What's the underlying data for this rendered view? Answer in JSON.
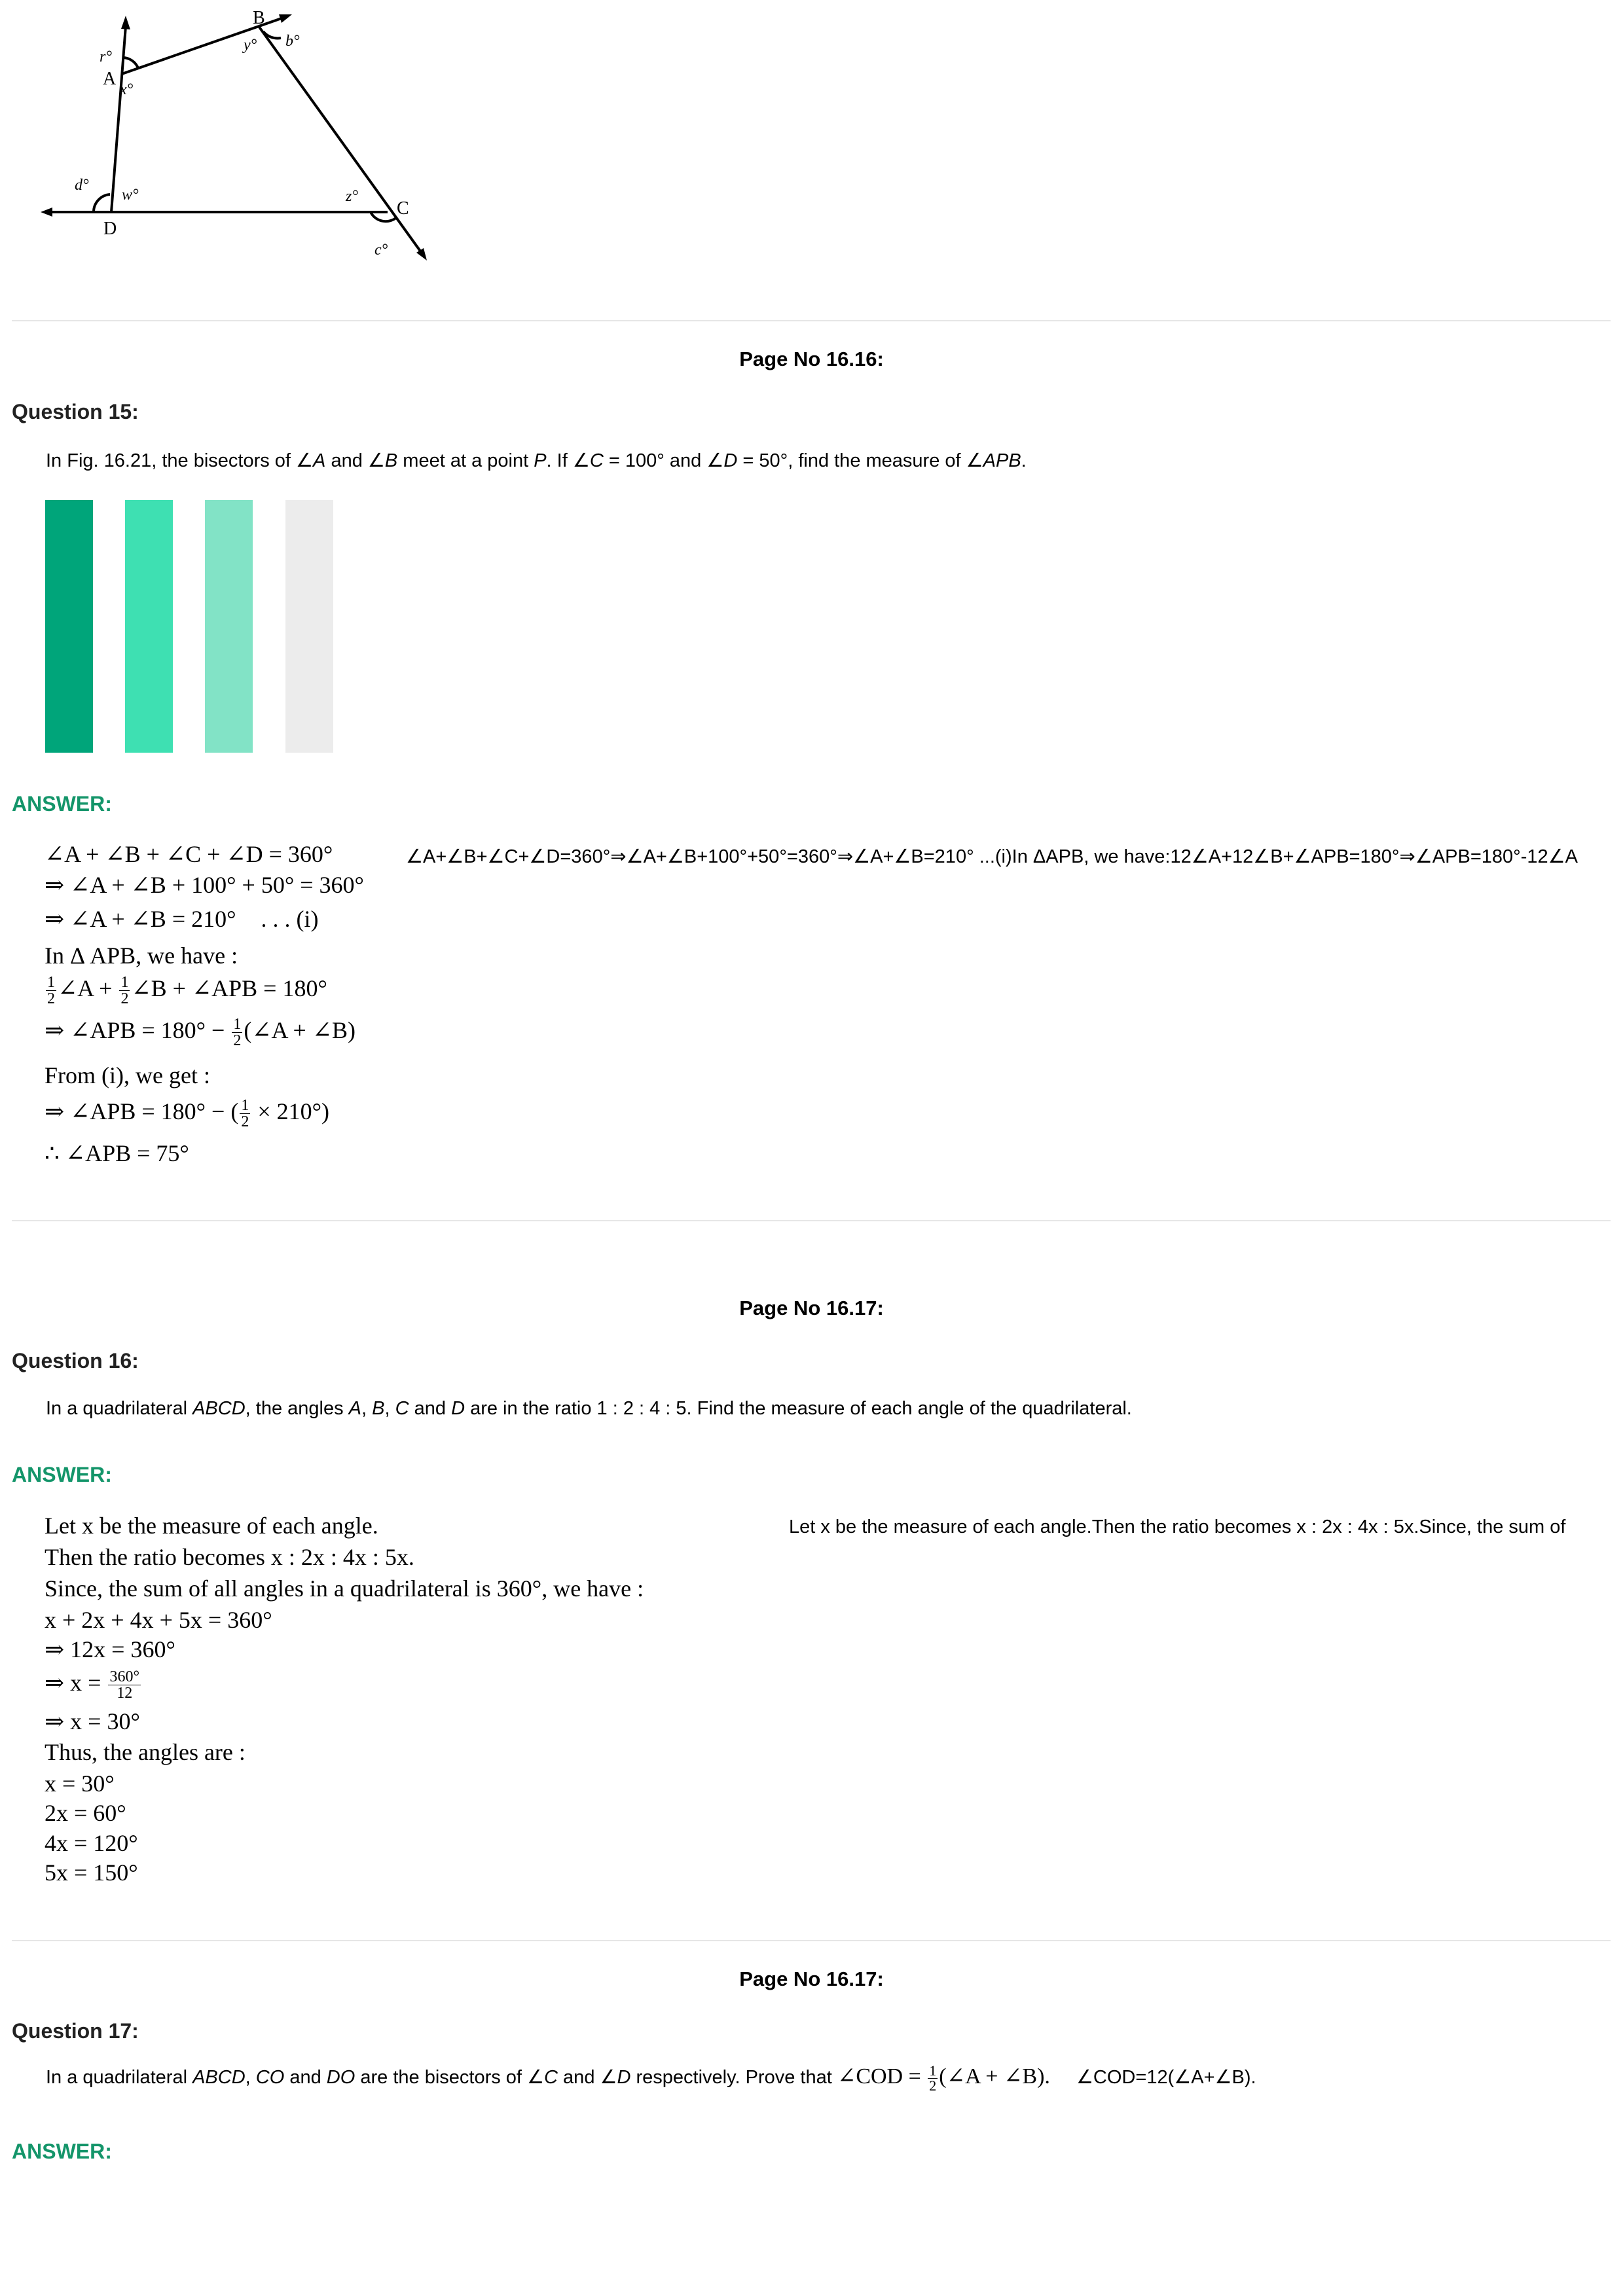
{
  "figure": {
    "labels": {
      "A": "A",
      "B": "B",
      "C": "C",
      "D": "D"
    },
    "angle_labels": {
      "r": "r°",
      "x": "x°",
      "y": "y°",
      "b": "b°",
      "z": "z°",
      "c": "c°",
      "d": "d°",
      "w": "w°"
    }
  },
  "section15": {
    "page_no": "Page No 16.16:",
    "question_title": "Question 15:",
    "question_parts": [
      "In Fig. 16.21, the bisectors of ",
      "∠A",
      " and ",
      "∠B",
      " meet at a point ",
      "P",
      ". If ",
      "∠C",
      " = 100° and ",
      "∠D",
      " = 50°, find the measure of ",
      "∠APB",
      "."
    ],
    "bars": [
      {
        "color": "#00a57a"
      },
      {
        "color": "#3ee0b2"
      },
      {
        "color": "#82e3c6"
      },
      {
        "color": "#ececec"
      }
    ],
    "answer_label": "ANSWER:",
    "lines": {
      "l1": "∠A + ∠B + ∠C + ∠D = 360°",
      "l2": "⇒ ∠A + ∠B + 100° + 50° = 360°",
      "l3a": "⇒ ∠A + ∠B = 210°",
      "l3b": ". . . (i)",
      "l4": "In   Δ APB,  we  have :",
      "l5_a": "∠A + ",
      "l5_b": "∠B + ∠APB = 180°",
      "l6_a": "⇒ ∠APB = 180° − ",
      "l6_b": "(∠A + ∠B)",
      "l7": "From  (i),  we  get :",
      "l8_a": "⇒ ∠APB = 180° − (",
      "l8_b": " × 210°)",
      "l9": "∴ ∠APB = 75°",
      "half_num": "1",
      "half_den": "2"
    },
    "alt_text": "∠A+∠B+∠C+∠D=360°⇒∠A+∠B+100°+50°=360°⇒∠A+∠B=210°     ...(i)In ΔAPB, we have:12∠A+12∠B+∠APB=180°⇒∠APB=180°-12∠A"
  },
  "section16": {
    "page_no": "Page No 16.17:",
    "question_title": "Question 16:",
    "question_parts": [
      "In a quadrilateral ",
      "ABCD",
      ", the angles ",
      "A",
      ", ",
      "B",
      ", ",
      "C",
      " and ",
      "D",
      " are in the ratio 1 : 2 : 4 : 5. Find the measure of each angle of the quadrilateral."
    ],
    "answer_label": "ANSWER:",
    "lines": {
      "l1": "Let  x  be  the  measure  of  each  angle.",
      "l2": "Then  the  ratio  becomes  x  :  2x  :  4x  :  5x.",
      "l3": "Since,  the  sum  of  all  angles  in  a  quadrilateral  is  360°,  we  have :",
      "l4": "x + 2x + 4x + 5x = 360°",
      "l5": "⇒ 12x = 360°",
      "l6_a": "⇒ x = ",
      "l6_num": "360°",
      "l6_den": "12",
      "l7": "⇒ x = 30°",
      "l8": "Thus,  the  angles  are :",
      "l9": "x = 30°",
      "l10": "2x = 60°",
      "l11": "4x = 120°",
      "l12": "5x = 150°"
    },
    "alt_text": "Let x be the measure of each angle.Then the ratio becomes x : 2x : 4x : 5x.Since, the sum of"
  },
  "section17": {
    "page_no": "Page No 16.17:",
    "question_title": "Question 17:",
    "question_parts": [
      "In a quadrilateral ",
      "ABCD",
      ", ",
      "CO",
      " and ",
      "DO",
      " are the bisectors of ",
      "∠C",
      " and ",
      "∠D",
      " respectively. Prove that "
    ],
    "formula_a": "∠COD = ",
    "formula_b": "(∠A + ∠B).",
    "half_num": "1",
    "half_den": "2",
    "alt_text": "∠COD=12(∠A+∠B).",
    "answer_label": "ANSWER:"
  }
}
